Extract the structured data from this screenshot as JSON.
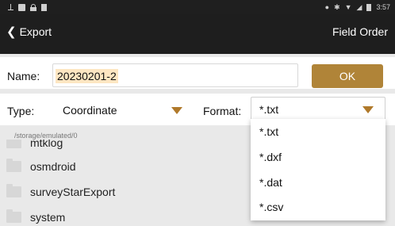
{
  "status_bar": {
    "time": "3:57",
    "icons": [
      "usb-icon",
      "image-icon",
      "lock-icon",
      "sim-icon",
      "location-icon",
      "bluetooth-icon",
      "wifi-icon",
      "signal-icon",
      "battery-icon"
    ]
  },
  "header": {
    "back_label": "Export",
    "action_label": "Field Order"
  },
  "name_row": {
    "label": "Name:",
    "value": "20230201-2",
    "ok_label": "OK"
  },
  "type_row": {
    "type_label": "Type:",
    "type_value": "Coordinate",
    "format_label": "Format:",
    "format_value": "*.txt"
  },
  "file_browser": {
    "path": "/storage/emulated/0",
    "items": [
      "mtklog",
      "osmdroid",
      "surveyStarExport",
      "system"
    ]
  },
  "format_dropdown": {
    "options": [
      "*.txt",
      "*.dxf",
      "*.dat",
      "*.csv"
    ]
  },
  "colors": {
    "accent": "#b08438",
    "arrow": "#b0792a",
    "highlight": "#fde6c2",
    "titlebar": "#1e1e1e"
  }
}
